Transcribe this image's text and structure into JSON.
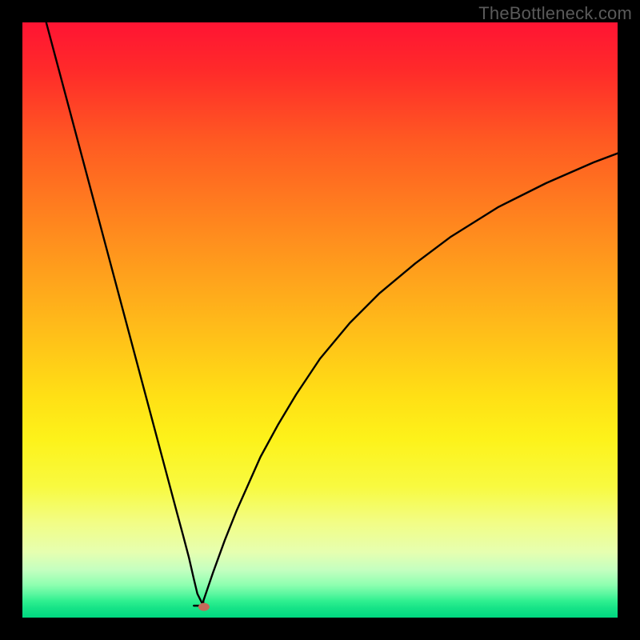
{
  "header": {
    "watermark": "TheBottleneck.com"
  },
  "chart_data": {
    "type": "line",
    "title": "",
    "xlabel": "",
    "ylabel": "",
    "xlim": [
      0,
      100
    ],
    "ylim": [
      0,
      100
    ],
    "gradient_bands": [
      {
        "y": 0,
        "color": "#ff1433"
      },
      {
        "y": 8,
        "color": "#ff2a2a"
      },
      {
        "y": 20,
        "color": "#ff5a22"
      },
      {
        "y": 35,
        "color": "#ff8a1e"
      },
      {
        "y": 50,
        "color": "#ffb81a"
      },
      {
        "y": 63,
        "color": "#ffe015"
      },
      {
        "y": 70,
        "color": "#fdf21a"
      },
      {
        "y": 78,
        "color": "#f8fa40"
      },
      {
        "y": 84,
        "color": "#f2fd85"
      },
      {
        "y": 89,
        "color": "#e6ffb0"
      },
      {
        "y": 92,
        "color": "#c4ffc0"
      },
      {
        "y": 94.5,
        "color": "#8effb0"
      },
      {
        "y": 96,
        "color": "#5cf7a0"
      },
      {
        "y": 97.2,
        "color": "#30f090"
      },
      {
        "y": 98.4,
        "color": "#16e387"
      },
      {
        "y": 100,
        "color": "#00d880"
      }
    ],
    "marker": {
      "x": 30.5,
      "y": 98.2,
      "color": "#c46a5a"
    },
    "series": [
      {
        "name": "left-branch",
        "x": [
          4,
          6,
          8,
          10,
          12,
          14,
          16,
          18,
          20,
          22,
          24,
          26,
          27,
          28,
          28.8,
          29.4,
          30.4
        ],
        "y": [
          0,
          7.5,
          15,
          22.5,
          30,
          37.5,
          45,
          52.5,
          60,
          67.5,
          75,
          82.5,
          86.2,
          90,
          93.5,
          96,
          98
        ]
      },
      {
        "name": "valley-bottom",
        "x": [
          28.8,
          30.4,
          30.4
        ],
        "y": [
          98,
          98,
          97.2
        ]
      },
      {
        "name": "right-branch",
        "x": [
          30.4,
          32,
          34,
          36,
          38,
          40,
          43,
          46,
          50,
          55,
          60,
          66,
          72,
          80,
          88,
          96,
          100
        ],
        "y": [
          97.2,
          92.5,
          87,
          82,
          77.5,
          73,
          67.5,
          62.5,
          56.5,
          50.5,
          45.5,
          40.5,
          36,
          31,
          27,
          23.5,
          22
        ]
      }
    ]
  }
}
